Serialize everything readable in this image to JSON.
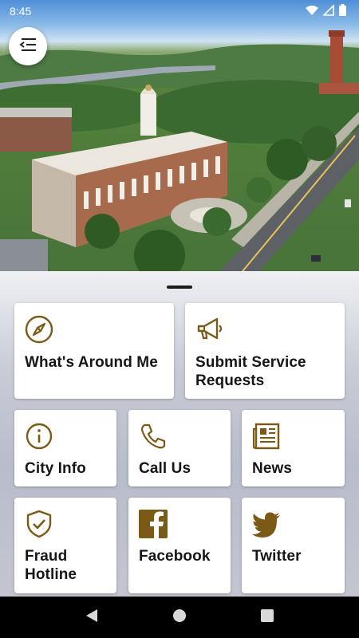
{
  "status_bar": {
    "time": "8:45",
    "icons": [
      "wifi-icon",
      "signal-icon",
      "battery-icon"
    ]
  },
  "hero": {
    "alt_icon": "city-hall-photo"
  },
  "menu_button": {
    "icon": "menu-collapse-icon"
  },
  "tiles": {
    "whats_around": {
      "label": "What's Around Me",
      "icon": "compass-icon"
    },
    "service_requests": {
      "label": "Submit Service Requests",
      "icon": "megaphone-icon"
    },
    "city_info": {
      "label": "City Info",
      "icon": "info-icon"
    },
    "call_us": {
      "label": "Call Us",
      "icon": "phone-icon"
    },
    "news": {
      "label": "News",
      "icon": "newspaper-icon"
    },
    "fraud_hotline": {
      "label": "Fraud Hotline",
      "icon": "shield-check-icon"
    },
    "facebook": {
      "label": "Facebook",
      "icon": "facebook-icon"
    },
    "twitter": {
      "label": "Twitter",
      "icon": "twitter-icon"
    }
  },
  "colors": {
    "accent": "#7a5a16",
    "tile_bg": "#ffffff",
    "text": "#161616"
  },
  "nav_bar": {
    "buttons": [
      "back-icon",
      "home-icon",
      "recents-icon"
    ]
  }
}
